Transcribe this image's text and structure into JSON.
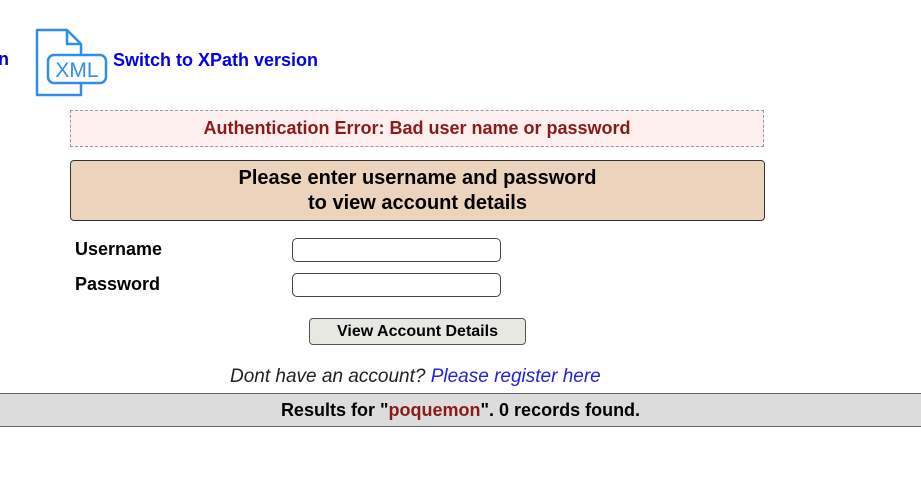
{
  "header": {
    "cutoff_text": "n",
    "xml_icon_text": "XML",
    "xpath_link": "Switch to XPath version"
  },
  "error": {
    "message": "Authentication Error: Bad user name or password"
  },
  "prompt": {
    "line1": "Please enter username and password",
    "line2": "to view account details"
  },
  "form": {
    "username_label": "Username",
    "password_label": "Password",
    "username_value": "",
    "password_value": "",
    "submit_label": "View Account Details"
  },
  "register": {
    "text": "Dont have an account? ",
    "link": "Please register here"
  },
  "results": {
    "prefix": "Results for \"",
    "query": "poquemon",
    "suffix": "\". 0 records found."
  },
  "colors": {
    "link": "#0000ee",
    "error_text": "#8b1a1a",
    "error_bg": "#fff0f0",
    "prompt_bg": "#ecd3bb",
    "results_bg": "#dcdcdc",
    "icon_blue": "#2f8fe8"
  }
}
